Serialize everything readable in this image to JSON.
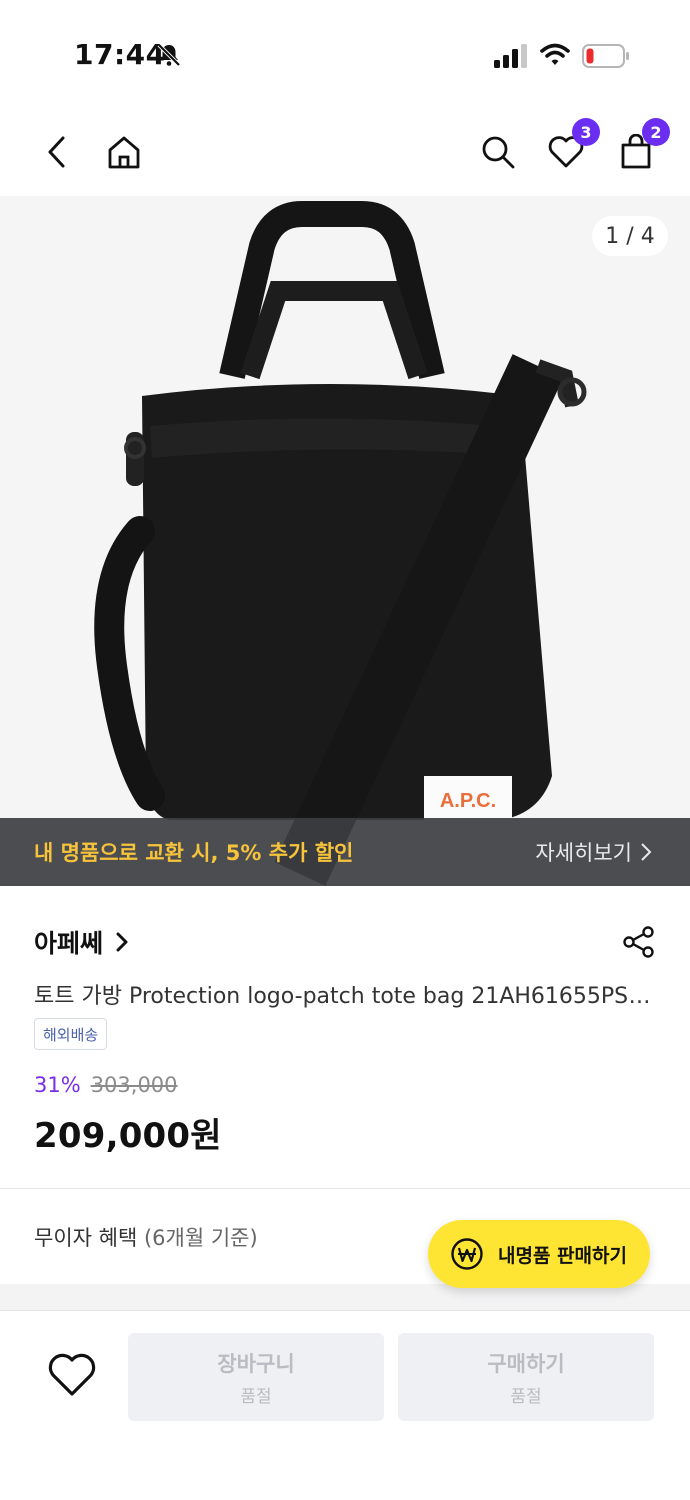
{
  "status": {
    "time": "17:44"
  },
  "header": {
    "wishlist_count": "3",
    "cart_count": "2"
  },
  "gallery": {
    "counter": "1 / 4",
    "logo_label": "A.P.C."
  },
  "promo": {
    "text": "내 명품으로 교환 시, 5% 추가 할인",
    "link": "자세히보기"
  },
  "product": {
    "brand": "아페쎄",
    "title": "토트 가방 Protection logo-patch tote bag 21AH61655PSA...",
    "tag": "해외배송",
    "discount": "31%",
    "original_price": "303,000",
    "price": "209,000원"
  },
  "installment": {
    "label": "무이자 혜택",
    "detail": "(6개월 기준)"
  },
  "sell_button": {
    "label": "내명품 판매하기"
  },
  "actions": {
    "cart": {
      "label": "장바구니",
      "status": "품절"
    },
    "buy": {
      "label": "구매하기",
      "status": "품절"
    }
  },
  "colors": {
    "accent": "#6b2ef0",
    "promo_text": "#f6c33b",
    "sell_button": "#ffe533"
  }
}
